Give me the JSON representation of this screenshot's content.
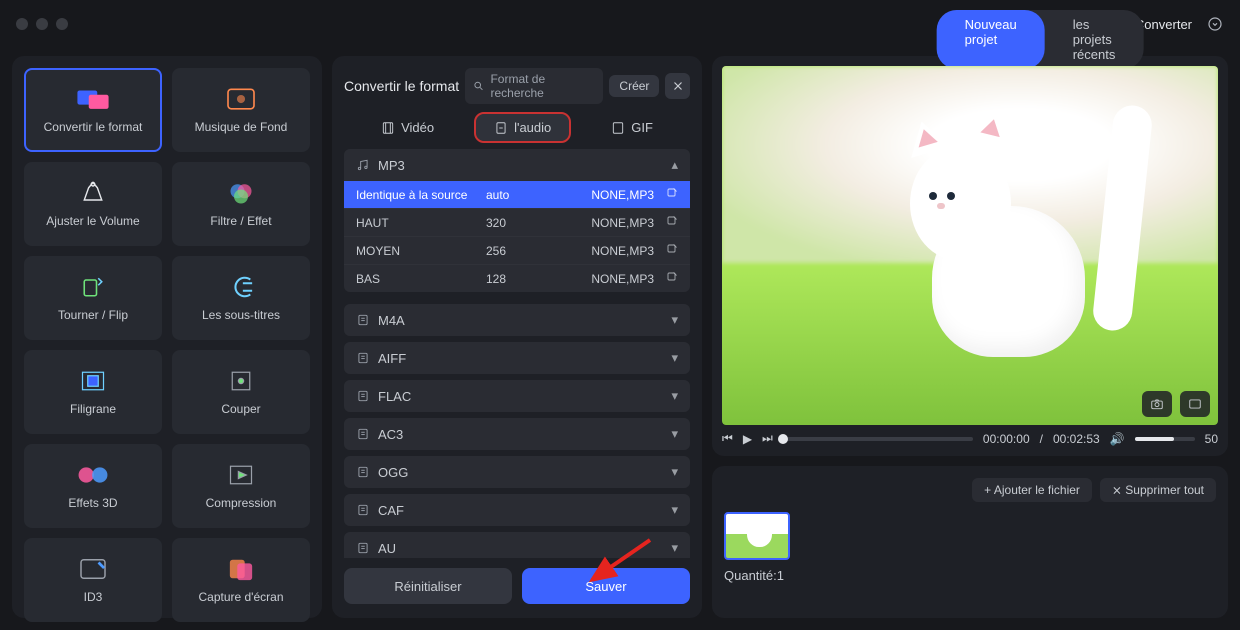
{
  "app": {
    "title": "iMyMac Video Converter"
  },
  "top_tabs": {
    "new": "Nouveau projet",
    "recent": "les projets récents"
  },
  "tools": [
    {
      "id": "convert",
      "label": "Convertir le format"
    },
    {
      "id": "music",
      "label": "Musique de Fond"
    },
    {
      "id": "volume",
      "label": "Ajuster le Volume"
    },
    {
      "id": "filter",
      "label": "Filtre / Effet"
    },
    {
      "id": "rotate",
      "label": "Tourner / Flip"
    },
    {
      "id": "subtitle",
      "label": "Les sous-titres"
    },
    {
      "id": "watermark",
      "label": "Filigrane"
    },
    {
      "id": "crop",
      "label": "Couper"
    },
    {
      "id": "3d",
      "label": "Effets 3D"
    },
    {
      "id": "compress",
      "label": "Compression"
    },
    {
      "id": "id3",
      "label": "ID3"
    },
    {
      "id": "capture",
      "label": "Capture d'écran"
    }
  ],
  "format": {
    "title": "Convertir le format",
    "search_placeholder": "Format de recherche",
    "create": "Créer",
    "tabs": {
      "video": "Vidéo",
      "audio": "l'audio",
      "gif": "GIF"
    },
    "mp3": {
      "name": "MP3",
      "presets": [
        {
          "name": "Identique à la source",
          "bitrate": "auto",
          "codec": "NONE,MP3"
        },
        {
          "name": "HAUT",
          "bitrate": "320",
          "codec": "NONE,MP3"
        },
        {
          "name": "MOYEN",
          "bitrate": "256",
          "codec": "NONE,MP3"
        },
        {
          "name": "BAS",
          "bitrate": "128",
          "codec": "NONE,MP3"
        }
      ]
    },
    "others": [
      "M4A",
      "AIFF",
      "FLAC",
      "AC3",
      "OGG",
      "CAF",
      "AU"
    ],
    "reset": "Réinitialiser",
    "save": "Sauver"
  },
  "player": {
    "current": "00:00:00",
    "duration": "00:02:53",
    "volume": "50"
  },
  "files": {
    "add": "Ajouter le fichier",
    "remove_all": "Supprimer tout",
    "qty_label": "Quantité:",
    "qty": "1"
  }
}
